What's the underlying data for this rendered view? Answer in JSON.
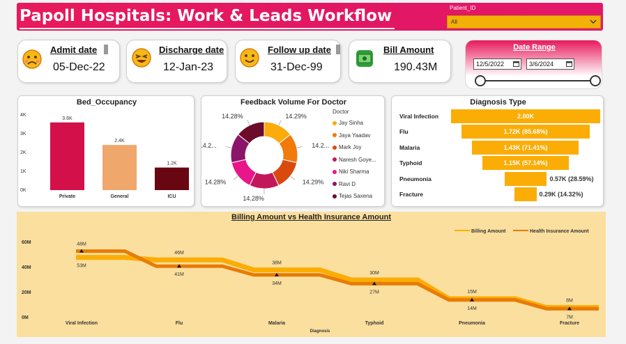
{
  "header": {
    "title": "Papoll Hospitals: Work & Leads Workflow"
  },
  "patient_filter": {
    "label": "Patient_ID",
    "value": "All"
  },
  "kpis": [
    {
      "label": "Admit date",
      "value": "05-Dec-22",
      "icon": "sad-face-icon"
    },
    {
      "label": "Discharge date",
      "value": "12-Jan-23",
      "icon": "grin-face-icon"
    },
    {
      "label": "Follow up date",
      "value": "31-Dec-99",
      "icon": "smile-face-icon"
    },
    {
      "label": "Bill Amount",
      "value": "190.43M",
      "icon": "money-icon"
    }
  ],
  "date_range": {
    "title": "Date Range",
    "start": "12/5/2022",
    "end": "3/6/2024",
    "selected_fraction_start": 0.0,
    "selected_fraction_end": 1.0
  },
  "bed_occupancy": {
    "title": "Bed_Occupancy",
    "yticks": [
      "0K",
      "1K",
      "2K",
      "3K",
      "4K"
    ]
  },
  "feedback": {
    "title": "Feedback Volume For Doctor",
    "legend_title": "Doctor",
    "doctors": [
      "Jay Sinha",
      "Jaya Yaadav",
      "Mark Joy",
      "Naresh Goye...",
      "Niki Sharma",
      "Ravi D",
      "Tejas Saxena"
    ],
    "slice_labels": [
      "14.29%",
      "14.2...",
      "14.29%",
      "14.28%",
      "14.28%",
      "14.2...",
      "14.28%"
    ]
  },
  "diagnosis": {
    "title": "Diagnosis Type",
    "rows": [
      {
        "label": "Viral Infection",
        "text": "2.00K"
      },
      {
        "label": "Flu",
        "text": "1.72K (85.68%)"
      },
      {
        "label": "Malaria",
        "text": "1.43K (71.41%)"
      },
      {
        "label": "Typhoid",
        "text": "1.15K (57.14%)"
      },
      {
        "label": "Pneumonia",
        "text": "0.57K (28.59%)"
      },
      {
        "label": "Fracture",
        "text": "0.29K (14.32%)"
      }
    ]
  },
  "billing": {
    "title": "Billing Amount vs Health Insurance Amount",
    "legend": [
      "Billing Amount",
      "Health Insurance Amount"
    ],
    "xlabel": "Diagnosis",
    "yticks": [
      "0M",
      "20M",
      "40M",
      "60M"
    ],
    "billing_labels": [
      "48M",
      "46M",
      "38M",
      "30M",
      "15M",
      "8M"
    ],
    "insurance_labels": [
      "53M",
      "41M",
      "34M",
      "27M",
      "14M",
      "7M"
    ]
  },
  "colors": {
    "brand": "#e5195e",
    "funnel": "#fbad05",
    "billing_line": "#fbad05",
    "insurance_line": "#e87b06",
    "billing_bg": "#fbdf9e"
  },
  "chart_data": [
    {
      "type": "bar",
      "title": "Bed_Occupancy",
      "categories": [
        "Private",
        "General",
        "ICU"
      ],
      "values": [
        3.6,
        2.4,
        1.2
      ],
      "value_labels": [
        "3.6K",
        "2.4K",
        "1.2K"
      ],
      "colors": [
        "#d4104a",
        "#f0a76b",
        "#680711"
      ],
      "ylim": [
        0,
        4
      ]
    },
    {
      "type": "pie",
      "title": "Feedback Volume For Doctor",
      "categories": [
        "Jay Sinha",
        "Jaya Yaadav",
        "Mark Joy",
        "Naresh Goye...",
        "Niki Sharma",
        "Ravi D",
        "Tejas Saxena"
      ],
      "values": [
        14.29,
        14.29,
        14.29,
        14.28,
        14.28,
        14.28,
        14.28
      ],
      "colors": [
        "#fbab0a",
        "#f07b0a",
        "#d94a0e",
        "#c2185b",
        "#e9168a",
        "#8b1569",
        "#6b0c2b"
      ]
    },
    {
      "type": "bar",
      "title": "Diagnosis Type",
      "categories": [
        "Viral Infection",
        "Flu",
        "Malaria",
        "Typhoid",
        "Pneumonia",
        "Fracture"
      ],
      "values": [
        2.0,
        1.72,
        1.43,
        1.15,
        0.57,
        0.29
      ]
    },
    {
      "type": "line",
      "title": "Billing Amount vs Health Insurance Amount",
      "xlabel": "Diagnosis",
      "categories": [
        "Viral Infection",
        "Flu",
        "Malaria",
        "Typhoid",
        "Pneumonia",
        "Fracture"
      ],
      "series": [
        {
          "name": "Billing Amount",
          "values": [
            48,
            46,
            38,
            30,
            15,
            8
          ]
        },
        {
          "name": "Health Insurance Amount",
          "values": [
            53,
            41,
            34,
            27,
            14,
            7
          ]
        }
      ],
      "ylim": [
        0,
        60
      ]
    }
  ]
}
